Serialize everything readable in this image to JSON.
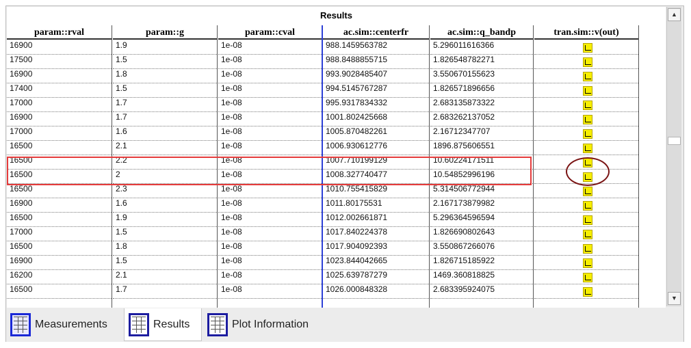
{
  "title": "Results",
  "columns": [
    "param::rval",
    "param::g",
    "param::cval",
    "ac.sim::centerfr",
    "ac.sim::q_bandp",
    "tran.sim::v(out)"
  ],
  "rows": [
    [
      "16900",
      "1.9",
      "1e-08",
      "988.1459563782",
      "5.296011616366"
    ],
    [
      "17500",
      "1.5",
      "1e-08",
      "988.8488855715",
      "1.826548782271"
    ],
    [
      "16900",
      "1.8",
      "1e-08",
      "993.9028485407",
      "3.550670155623"
    ],
    [
      "17400",
      "1.5",
      "1e-08",
      "994.5145767287",
      "1.826571896656"
    ],
    [
      "17000",
      "1.7",
      "1e-08",
      "995.9317834332",
      "2.683135873322"
    ],
    [
      "16900",
      "1.7",
      "1e-08",
      "1001.802425668",
      "2.683262137052"
    ],
    [
      "17000",
      "1.6",
      "1e-08",
      "1005.870482261",
      "2.16712347707"
    ],
    [
      "16500",
      "2.1",
      "1e-08",
      "1006.930612776",
      "1896.875606551"
    ],
    [
      "16500",
      "2.2",
      "1e-08",
      "1007.710199129",
      "10.60224171511"
    ],
    [
      "16500",
      "2",
      "1e-08",
      "1008.327740477",
      "10.54852996196"
    ],
    [
      "16500",
      "2.3",
      "1e-08",
      "1010.755415829",
      "5.314506772944"
    ],
    [
      "16900",
      "1.6",
      "1e-08",
      "1011.80175531",
      "2.167173879982"
    ],
    [
      "16500",
      "1.9",
      "1e-08",
      "1012.002661871",
      "5.296364596594"
    ],
    [
      "17000",
      "1.5",
      "1e-08",
      "1017.840224378",
      "1.826690802643"
    ],
    [
      "16500",
      "1.8",
      "1e-08",
      "1017.904092393",
      "3.550867266076"
    ],
    [
      "16900",
      "1.5",
      "1e-08",
      "1023.844042665",
      "1.826715185922"
    ],
    [
      "16200",
      "2.1",
      "1e-08",
      "1025.639787279",
      "1469.360818825"
    ],
    [
      "16500",
      "1.7",
      "1e-08",
      "1026.000848328",
      "2.683395924075"
    ]
  ],
  "wave_icon": "waveform-icon",
  "colors": {
    "selection": "#e53b3b",
    "circle": "#7a1414",
    "column_divider": "#2c3fd6"
  },
  "tabs": [
    {
      "label": "Measurements",
      "icon": "table-icon"
    },
    {
      "label": "Results",
      "icon": "table-icon",
      "active": true
    },
    {
      "label": "Plot Information",
      "icon": "table-icon"
    }
  ]
}
